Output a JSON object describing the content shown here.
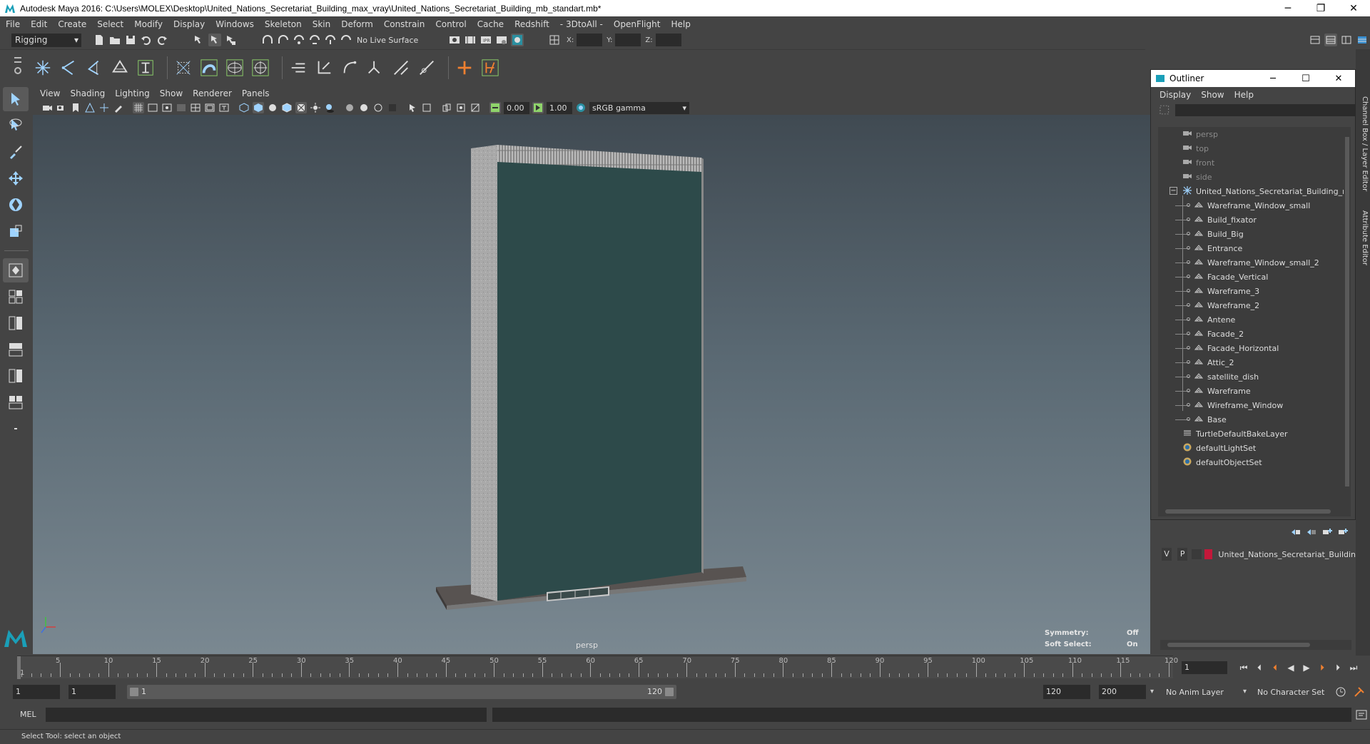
{
  "window": {
    "title": "Autodesk Maya 2016: C:\\Users\\MOLEX\\Desktop\\United_Nations_Secretariat_Building_max_vray\\United_Nations_Secretariat_Building_mb_standart.mb*",
    "minimize": "─",
    "restore": "❐",
    "close": "✕"
  },
  "menubar": [
    "File",
    "Edit",
    "Create",
    "Select",
    "Modify",
    "Display",
    "Windows",
    "Skeleton",
    "Skin",
    "Deform",
    "Constrain",
    "Control",
    "Cache",
    "Redshift",
    "- 3DtoAll -",
    "OpenFlight",
    "Help"
  ],
  "statusline": {
    "mode": "Rigging",
    "live_surface": "No Live Surface",
    "x_label": "X:",
    "y_label": "Y:",
    "z_label": "Z:"
  },
  "panel_menu": [
    "View",
    "Shading",
    "Lighting",
    "Show",
    "Renderer",
    "Panels"
  ],
  "panel_toolbar": {
    "near": "0.00",
    "far": "1.00",
    "color_space": "sRGB gamma"
  },
  "viewport": {
    "camera": "persp",
    "hud": {
      "symmetry_label": "Symmetry:",
      "symmetry_value": "Off",
      "soft_select_label": "Soft Select:",
      "soft_select_value": "On"
    },
    "colors": {
      "glass": "#2d4a4a",
      "concrete": "#a8a8a8",
      "base": "#5a5553"
    }
  },
  "outliner": {
    "title": "Outliner",
    "menu": [
      "Display",
      "Show",
      "Help"
    ],
    "cameras": [
      "persp",
      "top",
      "front",
      "side"
    ],
    "root": "United_Nations_Secretariat_Building_nc",
    "children": [
      "Wareframe_Window_small",
      "Build_fixator",
      "Build_Big",
      "Entrance",
      "Wareframe_Window_small_2",
      "Facade_Vertical",
      "Wareframe_3",
      "Wareframe_2",
      "Antene",
      "Facade_2",
      "Facade_Horizontal",
      "Attic_2",
      "satellite_dish",
      "Wareframe",
      "Wireframe_Window",
      "Base"
    ],
    "sets": [
      "TurtleDefaultBakeLayer",
      "defaultLightSet",
      "defaultObjectSet"
    ]
  },
  "side_tabs": {
    "channel_box": "Channel Box / Layer Editor",
    "attribute_editor": "Attribute Editor"
  },
  "layer": {
    "v": "V",
    "p": "P",
    "name": "United_Nations_Secretariat_Buildin",
    "color": "#c3183a"
  },
  "timeline": {
    "ticks": [
      "5",
      "10",
      "15",
      "20",
      "25",
      "30",
      "35",
      "40",
      "45",
      "50",
      "55",
      "60",
      "65",
      "70",
      "75",
      "80",
      "85",
      "90",
      "95",
      "100",
      "105",
      "110",
      "115",
      "120"
    ],
    "start_mark": "1",
    "current_frame": "1"
  },
  "range": {
    "start": "1",
    "playback_start": "1",
    "slider_start": "1",
    "slider_end": "120",
    "playback_end": "120",
    "end": "200",
    "anim_layer": "No Anim Layer",
    "character_set": "No Character Set"
  },
  "cmdline": {
    "label": "MEL"
  },
  "helpline": {
    "text": "Select Tool: select an object"
  }
}
